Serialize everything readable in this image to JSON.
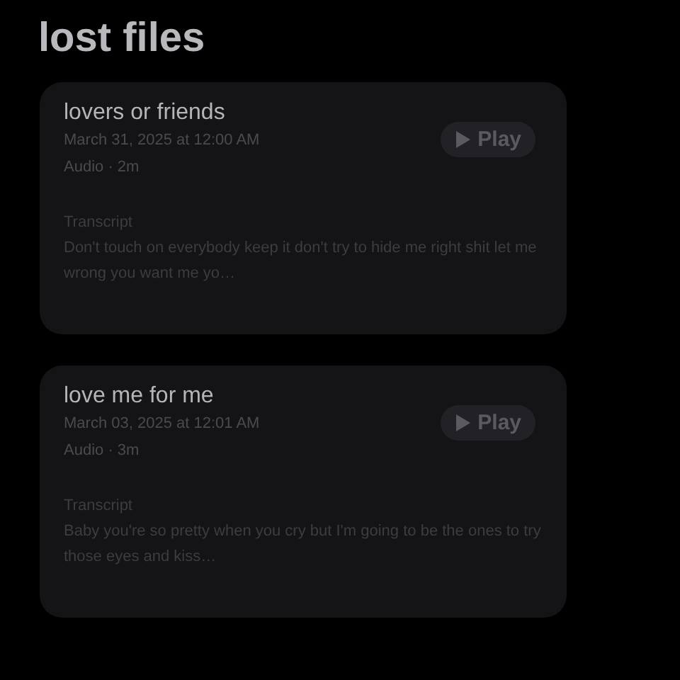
{
  "title": "lost files",
  "recordings": [
    {
      "name": "lovers or friends",
      "date": "March 31, 2025 at 12:00 AM",
      "meta": "Audio · 2m",
      "play_label": "Play",
      "transcript_label": "Transcript",
      "transcript": "Don't touch on everybody keep it don't try to hide me right shit let me wrong you want me yo…"
    },
    {
      "name": "love me for me",
      "date": "March 03, 2025 at 12:01 AM",
      "meta": "Audio · 3m",
      "play_label": "Play",
      "transcript_label": "Transcript",
      "transcript": "Baby you're so pretty when you cry but I'm going to be the ones to try those eyes and kiss…"
    }
  ]
}
